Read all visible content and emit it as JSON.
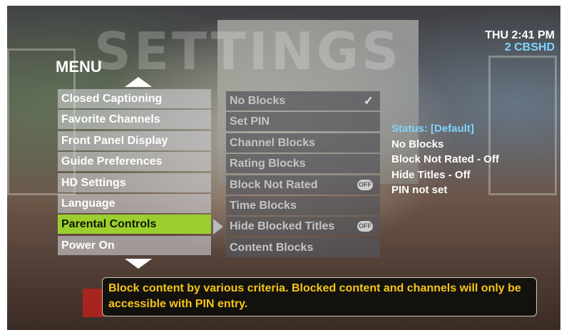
{
  "header": {
    "watermark": "SETTINGS",
    "time": "THU 2:41 PM",
    "channel": "2 CBSHD"
  },
  "menu": {
    "title": "MENU",
    "items": [
      "Closed Captioning",
      "Favorite Channels",
      "Front Panel Display",
      "Guide Preferences",
      "HD Settings",
      "Language",
      "Parental Controls",
      "Power On"
    ],
    "active_index": 6
  },
  "submenu": {
    "items": [
      "No Blocks",
      "Set PIN",
      "Channel Blocks",
      "Rating Blocks",
      "Block Not Rated",
      "Time Blocks",
      "Hide Blocked Titles",
      "Content Blocks"
    ],
    "selected_check": "✓",
    "off_label": "OFF"
  },
  "status": {
    "title": "Status: [Default]",
    "lines": [
      "No Blocks",
      "Block Not Rated - Off",
      "Hide Titles - Off",
      "PIN not set"
    ]
  },
  "help": {
    "text": "Block content by various criteria. Blocked content and channels will only be accessible with PIN entry."
  },
  "colors": {
    "accent": "#9ccf2e",
    "status_title": "#7fd4ff",
    "help_text": "#f5c518"
  }
}
